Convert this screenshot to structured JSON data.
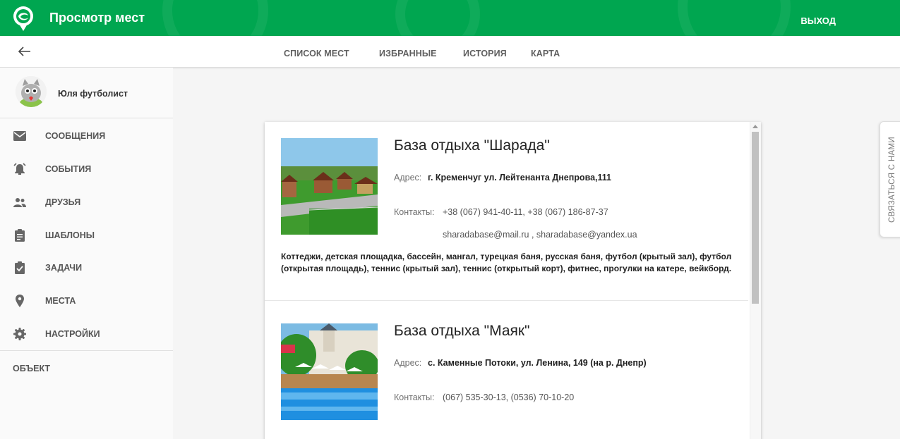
{
  "header": {
    "title": "Просмотр мест",
    "logout_label": "ВЫХОД",
    "brand_color": "#00a650"
  },
  "toolbar": {
    "tabs": [
      {
        "label": "СПИСОК МЕСТ"
      },
      {
        "label": "ИЗБРАННЫЕ"
      },
      {
        "label": "ИСТОРИЯ"
      },
      {
        "label": "КАРТА"
      }
    ]
  },
  "sidebar": {
    "user_name": "Юля футболист",
    "items": [
      {
        "label": "СООБЩЕНИЯ",
        "icon": "mail-icon"
      },
      {
        "label": "СОБЫТИЯ",
        "icon": "alarm-bell-icon"
      },
      {
        "label": "ДРУЗЬЯ",
        "icon": "people-icon"
      },
      {
        "label": "ШАБЛОНЫ",
        "icon": "clipboard-icon"
      },
      {
        "label": "ЗАДАЧИ",
        "icon": "clipboard-check-icon"
      },
      {
        "label": "МЕСТА",
        "icon": "location-pin-icon"
      },
      {
        "label": "НАСТРОЙКИ",
        "icon": "gear-icon"
      }
    ],
    "section_label": "ОБЪЕКТ"
  },
  "places": [
    {
      "name": "База отдыха \"Шарада\"",
      "address_label": "Адрес:",
      "address": "г. Кременчуг ул. Лейтенанта Днепрова,111",
      "contacts_label": "Контакты:",
      "phones": "+38 (067) 941-40-11, +38 (067) 186-87-37",
      "emails": "sharadabase@mail.ru , sharadabase@yandex.ua",
      "description": "Коттеджи, детская площадка, бассейн, мангал, турецкая баня, русская баня, футбол (крытый зал), футбол (открытая площадь), теннис (крытый зал), теннис (открытый корт), фитнес, прогулки на катере, вейкборд."
    },
    {
      "name": "База отдыха \"Маяк\"",
      "address_label": "Адрес:",
      "address": "с. Каменные Потоки, ул. Ленина, 149 (на р. Днепр)",
      "contacts_label": "Контакты:",
      "phones": "(067) 535-30-13, (0536) 70-10-20"
    }
  ],
  "contact_tab": {
    "label": "СВЯЗАТЬСЯ С НАМИ"
  }
}
